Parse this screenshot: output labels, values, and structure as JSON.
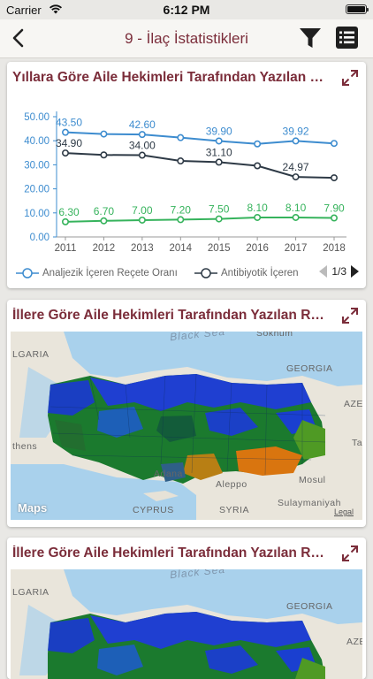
{
  "status": {
    "carrier": "Carrier",
    "time": "6:12 PM"
  },
  "nav": {
    "title": "9 - İlaç İstatistikleri"
  },
  "cards": [
    {
      "title": "Yıllara Göre Aile Hekimleri Tarafından Yazılan Reçeteler"
    },
    {
      "title": "İllere Göre Aile Hekimleri Tarafından Yazılan Reçeteler",
      "map_labels": {
        "black_sea": "Black Sea",
        "bulgaria": "LGARIA",
        "georgia": "GEORGIA",
        "azer": "AZEI",
        "athens": "thens",
        "adana": "Adana",
        "aleppo": "Aleppo",
        "mosul": "Mosul",
        "cyprus": "CYPRUS",
        "syria": "SYRIA",
        "sulaymaniyah": "Sulaymaniyah",
        "tab": "Ta",
        "sokhumi": "Sokhum",
        "maps": "Maps",
        "legal": "Legal"
      }
    },
    {
      "title": "İllere Göre Aile Hekimleri Tarafından Yazılan Reçeteler",
      "map_labels": {
        "black_sea": "Black Sea",
        "bulgaria": "LGARIA",
        "georgia": "GEORGIA",
        "azer": "AZE"
      }
    }
  ],
  "chart_data": {
    "type": "line",
    "x": [
      "2011",
      "2012",
      "2013",
      "2014",
      "2015",
      "2016",
      "2017",
      "2018"
    ],
    "ylim": [
      0,
      50
    ],
    "yticks": [
      "0.00",
      "10.00",
      "20.00",
      "30.00",
      "40.00",
      "50.00"
    ],
    "series": [
      {
        "name": "Analjezik İçeren Reçete Oranı",
        "color": "#3d8ccf",
        "values": [
          43.5,
          42.8,
          42.6,
          41.3,
          39.9,
          38.7,
          39.92,
          38.9
        ],
        "labels": {
          "0": "43.50",
          "2": "42.60",
          "4": "39.90",
          "6": "39.92"
        }
      },
      {
        "name": "Antibiyotik İçeren",
        "color": "#2e3a46",
        "values": [
          34.9,
          34.1,
          34.0,
          31.6,
          31.1,
          29.6,
          24.97,
          24.6
        ],
        "labels": {
          "0": "34.90",
          "2": "34.00",
          "4": "31.10",
          "6": "24.97"
        }
      },
      {
        "name": "",
        "color": "#36b35c",
        "values": [
          6.3,
          6.7,
          7.0,
          7.2,
          7.5,
          8.1,
          8.1,
          7.9
        ],
        "labels": {
          "0": "6.30",
          "1": "6.70",
          "2": "7.00",
          "3": "7.20",
          "4": "7.50",
          "5": "8.10",
          "6": "8.10",
          "7": "7.90"
        }
      }
    ],
    "legend_page": "1/3",
    "grid": false
  }
}
